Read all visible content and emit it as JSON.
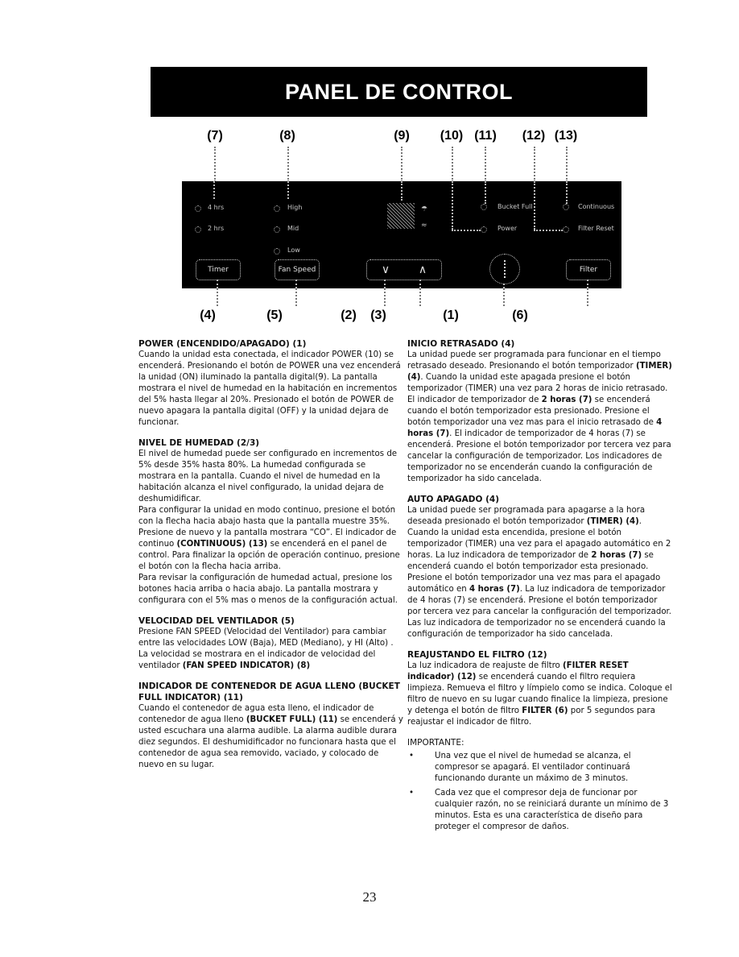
{
  "title": "PANEL DE CONTROL",
  "callouts_top": [
    "(7)",
    "(8)",
    "(9)",
    "(10)",
    "(11)",
    "(12)",
    "(13)"
  ],
  "callouts_bottom": [
    "(4)",
    "(5)",
    "(2)",
    "(3)",
    "(1)",
    "(6)"
  ],
  "panel": {
    "timer_indicators": [
      "4 hrs",
      "2 hrs"
    ],
    "fan_indicators": [
      "High",
      "Mid",
      "Low"
    ],
    "status_indicators": [
      "Bucket Full",
      "Power",
      "Continuous",
      "Filter Reset"
    ],
    "buttons": {
      "timer": "Timer",
      "fan_speed": "Fan Speed",
      "down": "∨",
      "up": "∧",
      "filter": "Filter"
    },
    "display_icons": [
      "humidity-icon",
      "fan-icon"
    ]
  },
  "left_column": [
    {
      "heading": "POWER (ENCENDIDO/APAGADO) (1)",
      "body": "Cuando la unidad esta conectada, el indicador POWER (10) se encenderá. Presionando el botón de POWER una vez encenderá la unidad (ON) iluminado la pantalla digital(9). La pantalla mostrara el nivel de humedad en la habitación en incrementos del 5% hasta llegar al 20%. Presionado el botón de POWER de nuevo apagara la pantalla digital (OFF) y la unidad dejara de funcionar."
    },
    {
      "heading": "NIVEL DE HUMEDAD (2/3)",
      "body": "El nivel de humedad puede ser configurado en incrementos de 5% desde 35% hasta 80%. La humedad configurada se mostrara en la pantalla. Cuando el nivel de humedad en la habitación alcanza el nivel configurado, la unidad dejara de deshumidificar.",
      "body2_pre": "Para configurar la unidad en modo continuo, presione el botón con la flecha hacia abajo hasta que la pantalla muestre 35%. Presione de nuevo y la pantalla mostrara “CO”. El indicador de continuo ",
      "body2_bold": "(CONTINUOUS) (13)",
      "body2_post": " se encenderá en el panel de control. Para finalizar la opción de operación continuo, presione el botón con la flecha hacia arriba.",
      "body3": "Para revisar la configuración de humedad actual, presione los botones hacia arriba o hacia abajo. La pantalla mostrara y configurara con el 5% mas o menos de la configuración actual."
    },
    {
      "heading": "VELOCIDAD DEL VENTILADOR (5)",
      "body_pre": "Presione FAN SPEED (Velocidad del Ventilador) para cambiar entre las velocidades LOW (Baja), MED (Mediano), y HI (Alto) . La velocidad se mostrara en el indicador de velocidad del ventilador ",
      "body_bold": "(FAN SPEED INDICATOR) (8)"
    },
    {
      "heading": "INDICADOR DE CONTENEDOR DE AGUA LLENO (BUCKET FULL INDICATOR) (11)",
      "body_pre": "Cuando el contenedor de agua esta lleno, el indicador de contenedor de agua lleno ",
      "body_bold": "(BUCKET FULL) (11)",
      "body_post": " se encenderá y usted escuchara una alarma audible. La alarma audible durara diez segundos. El deshumidificador no funcionara hasta que el contenedor de agua sea removido, vaciado, y colocado de nuevo en su lugar."
    }
  ],
  "right_column": [
    {
      "heading": "INICIO RETRASADO (4)",
      "p1": "La unidad puede ser programada para funcionar en el tiempo retrasado deseado. Presionando el botón temporizador ",
      "b1": "(TIMER) (4)",
      "p2": ". Cuando la unidad este apagada presione el botón temporizador (TIMER) una vez para 2 horas de inicio retrasado. El indicador de temporizador de ",
      "b2": "2 horas (7)",
      "p3": " se encenderá cuando el botón temporizador esta presionado. Presione el botón temporizador una vez mas para el inicio retrasado de ",
      "b3": "4 horas (7)",
      "p4": ". El indicador de temporizador de 4 horas (7) se encenderá. Presione el botón temporizador por tercera vez para cancelar la configuración de temporizador. Los indicadores de temporizador no se encenderán cuando la configuración de temporizador ha sido cancelada."
    },
    {
      "heading": "AUTO APAGADO (4)",
      "p1": "La unidad puede ser programada para apagarse a la hora deseada presionado el botón temporizador ",
      "b1": "(TIMER) (4)",
      "p2": ". Cuando la unidad esta encendida, presione el botón temporizador (TIMER) una vez para el apagado automático en 2 horas. La luz indicadora de temporizador de ",
      "b2": "2 horas (7)",
      "p3": " se encenderá cuando el botón temporizador esta presionado. Presione el botón temporizador una vez mas para el apagado automático en ",
      "b3": "4 horas (7)",
      "p4": ". La luz indicadora de temporizador de 4 horas (7) se encenderá. Presione el botón temporizador por tercera vez para cancelar la configuración del temporizador. Las luz indicadora de temporizador no se encenderá cuando la configuración de temporizador ha sido cancelada."
    },
    {
      "heading": "REAJUSTANDO EL FILTRO (12)",
      "p1": "La luz indicadora de reajuste de filtro ",
      "b1": "(FILTER RESET indicador) (12)",
      "p2": " se encenderá cuando el filtro requiera limpieza. Remueva el filtro y límpielo como se indica. Coloque el filtro de nuevo en su lugar cuando finalice la limpieza, presione y detenga el botón de filtro ",
      "b2": "FILTER (6)",
      "p3": " por 5 segundos para reajustar el indicador de filtro."
    },
    {
      "heading": "IMPORTANTE:",
      "bullet": "•",
      "items": [
        "Una vez que el nivel de humedad se alcanza, el compresor se apagará. El ventilador continuará funcionando durante un máximo de 3 minutos.",
        "Cada vez que el compresor deja de funcionar por cualquier razón, no se reiniciará durante un mínimo de 3 minutos. Esta es una característica de diseño para proteger el compresor de daños."
      ]
    }
  ],
  "page_number": "23"
}
